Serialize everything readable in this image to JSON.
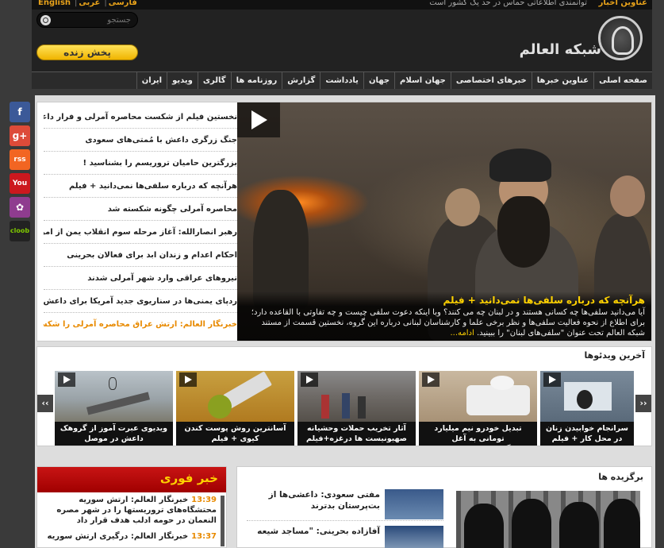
{
  "topbar": {
    "languages": [
      "English",
      "فارسی",
      "عربی"
    ],
    "ticker_text": "توانمندی اطلاعاتی حماس در حد یک کشور است",
    "ticker_label": "عناوین اخبار"
  },
  "header": {
    "search_placeholder": "جستجو",
    "live_label": "پخش زنده",
    "logo_text": "شبکه العالم"
  },
  "nav": {
    "items": [
      "صفحه اصلی",
      "عناوین خبرها",
      "خبرهای اختصاصی",
      "جهان اسلام",
      "جهان",
      "یادداشت",
      "گزارش",
      "روزنامه ها",
      "گالری",
      "ویدیو",
      "ایران"
    ]
  },
  "social": [
    {
      "label": "f",
      "color": "#3b5998"
    },
    {
      "label": "g+",
      "color": "#dd4b39"
    },
    {
      "label": "rss",
      "color": "#f26522"
    },
    {
      "label": "You",
      "color": "#cc181e"
    },
    {
      "label": "✿",
      "color": "#8f3c8f"
    },
    {
      "label": "cloob",
      "color": "#222222"
    }
  ],
  "headlines": [
    "نخستین فیلم از شکست محاصره آمرلی و فرار داعش",
    "جنگ زرگری داعش با مُمتی‌های سعودی",
    "بزرگترین حامیان تروریسم را بشناسید !",
    "هرآنچه که درباره سلفی‌ها نمی‌دانید + فیلم",
    "محاصره آمرلی چگونه شکسته شد",
    "رهبر انصارالله: آغاز مرحله سوم انقلاب یمن از امروز",
    "احکام اعدام و زندان ابد برای فعالان بحرینی",
    "نیروهای عراقی وارد شهر آمرلی شدند",
    "ردپای یمنی‌ها در سناریوی جدید آمریکا برای داعش",
    "خبرنگار العالم: ارتش عراق محاصره آمرلی را شکست"
  ],
  "feature": {
    "title": "هرآنچه که درباره سلفی‌ها نمی‌دانید + فیلم",
    "text": "آیا می‌دانید سلفی‌ها چه کسانی هستند و در لبنان چه می کنند؟ وبا اینکه دعوت سلفی چیست و چه تفاوتی با القاعده دارد؛ برای اطلاع از نحوه فعالیت سلفی‌ها و نظر برخی علما و کارشناسان لبنانی درباره این گروه، نخستین قسمت از مستند شبکه العالم تحت عنوان \"سلفی‌های لبنان\" را ببینید.",
    "more": "ادامه..."
  },
  "videos": {
    "title": "آخرین ویدئوها",
    "prev": "‹‹",
    "next": "››",
    "items": [
      "سرانجام خوابیدن زنان در محل کار + فیلم",
      "تبدیل خودرو نیم میلیارد تومانی به آغل گوسفندان!+فیلم",
      "آثار تخریب حملات وحشیانه صهیونیست ها درغزه+فیلم",
      "آسانترین روش پوست کندن کیوی + فیلم",
      "ویدیوی عبرت آموز از گروهک داعش در موصل"
    ]
  },
  "breaking": {
    "title": "خبر فوری",
    "items": [
      {
        "time": "13:39",
        "text": "خبرنگار العالم: ارتش سوریه محتشگاه‌های تروریستها را در شهر مصره النعمان در حومه ادلب هدف قرار داد"
      },
      {
        "time": "13:37",
        "text": "خبرنگار العالم: درگیری ارتش سوریه"
      }
    ]
  },
  "picks": {
    "title": "برگزیده ها",
    "items": [
      "مفتی سعودی: داعشی‌ها از بت‌پرستان بدترند",
      "آفازاده بحرینی: \"مساجد شیعه"
    ]
  }
}
